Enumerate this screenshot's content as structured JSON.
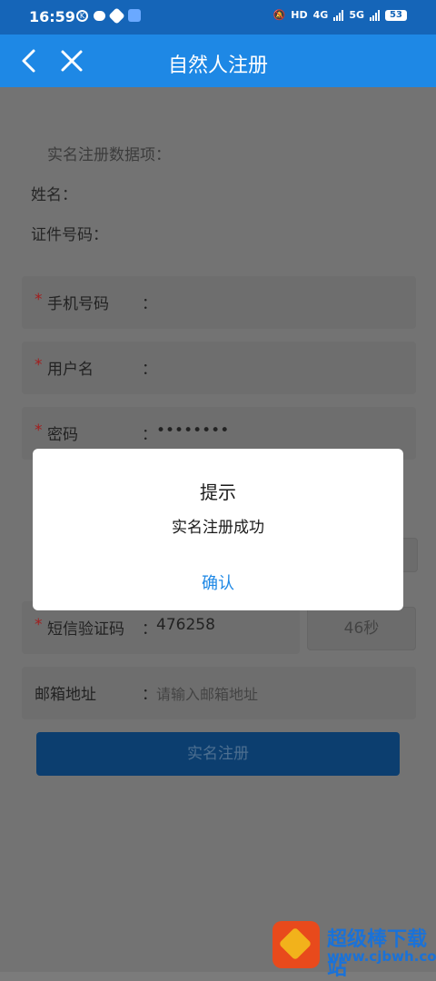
{
  "status_bar": {
    "time": "16:59",
    "k_badge": "K",
    "network_hd": "HD",
    "network_4g": "4G",
    "network_5g": "5G",
    "battery": "53"
  },
  "nav": {
    "title": "自然人注册",
    "back_icon": "chevron-left-icon",
    "close_icon": "close-icon"
  },
  "form": {
    "section_title": "实名注册数据项：",
    "name_label": "姓名：",
    "id_label": "证件号码：",
    "required_mark": "*",
    "colon": "：",
    "phone": {
      "label": "手机号码",
      "value": ""
    },
    "username": {
      "label": "用户名",
      "value": ""
    },
    "password": {
      "label": "密码",
      "value": "••••••••"
    },
    "sms": {
      "label": "短信验证码",
      "value": "476258",
      "countdown": "46秒"
    },
    "email": {
      "label": "邮箱地址",
      "placeholder": "请输入邮箱地址"
    },
    "submit_label": "实名注册"
  },
  "dialog": {
    "title": "提示",
    "message": "实名注册成功",
    "confirm_label": "确认"
  },
  "watermark": {
    "text": "超级棒下载站",
    "url": "www.cjbwh.com"
  }
}
